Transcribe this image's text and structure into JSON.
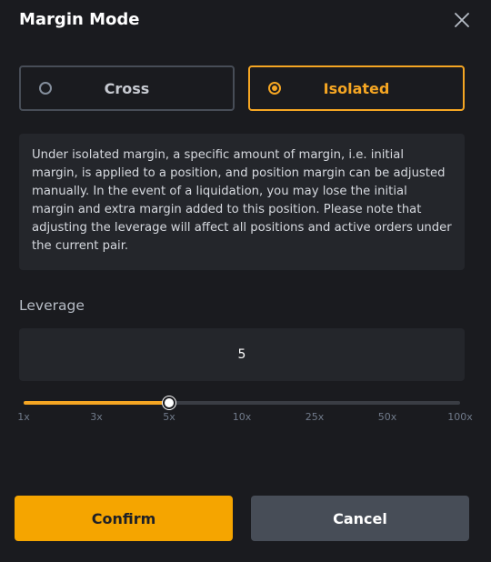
{
  "dialog": {
    "title": "Margin Mode"
  },
  "mode": {
    "options": [
      {
        "label": "Cross",
        "selected": false
      },
      {
        "label": "Isolated",
        "selected": true
      }
    ]
  },
  "description": "Under isolated margin, a specific amount of margin, i.e. initial margin, is applied to a position, and position margin can be adjusted manually. In the event of a liquidation, you may lose the initial margin and extra margin added to this position. Please note that adjusting the leverage will affect all positions and active orders under the current pair.",
  "leverage": {
    "label": "Leverage",
    "value": "5",
    "slider_fraction": 0.333,
    "ticks": [
      "1x",
      "3x",
      "5x",
      "10x",
      "25x",
      "50x",
      "100x"
    ]
  },
  "buttons": {
    "confirm": "Confirm",
    "cancel": "Cancel"
  },
  "colors": {
    "accent": "#f5a623",
    "background": "#1a1b1f",
    "panel": "#24262b"
  },
  "icons": {
    "close": "close-icon"
  }
}
